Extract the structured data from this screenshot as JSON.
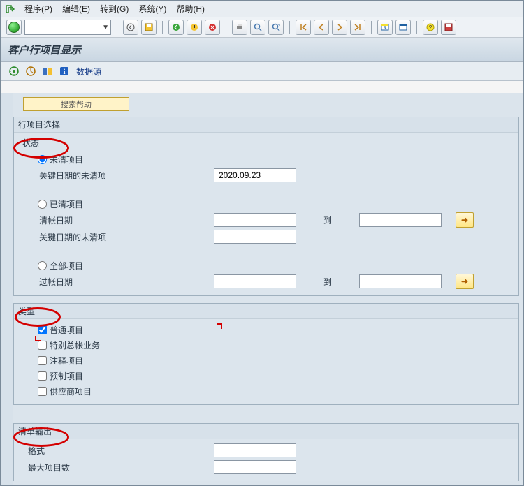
{
  "menu": {
    "program": "程序(P)",
    "edit": "编辑(E)",
    "goto": "转到(G)",
    "system": "系统(Y)",
    "help": "帮助(H)"
  },
  "title": "客户行项目显示",
  "apptb": {
    "datasource": "数据源"
  },
  "stub": "搜索帮助",
  "g1": {
    "title": "行项目选择",
    "status": "状态",
    "opt_open": "未清项目",
    "open_key_date": "关键日期的未清项",
    "open_date_val": "2020.09.23",
    "opt_cleared": "已清项目",
    "clearing_date": "清帐日期",
    "to": "到",
    "key_date": "关键日期的未清项",
    "opt_all": "全部项目",
    "posting_date": "过帐日期"
  },
  "g2": {
    "title": "类型",
    "c1": "普通项目",
    "c2": "特别总帐业务",
    "c3": "注释项目",
    "c4": "预制项目",
    "c5": "供应商项目"
  },
  "g3": {
    "title": "清单输出",
    "layout": "格式",
    "max": "最大项目数"
  }
}
